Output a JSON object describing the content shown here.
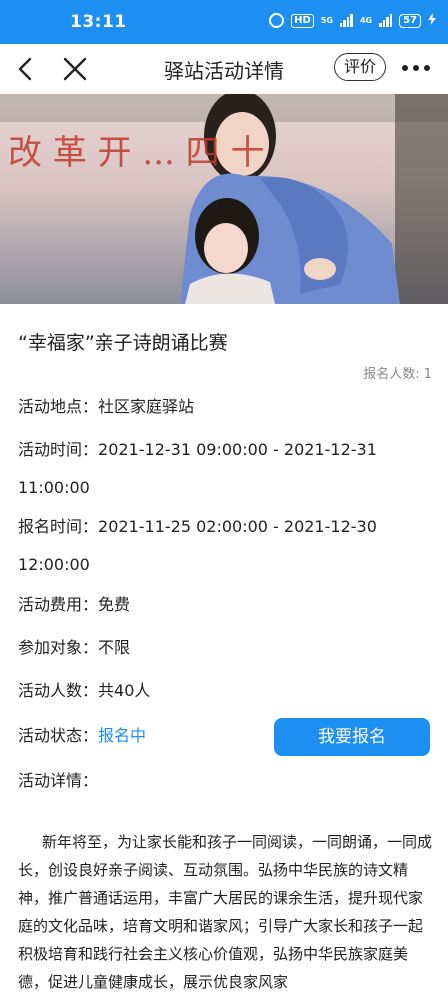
{
  "status_bar": {
    "time": "13:11",
    "hd": "HD",
    "net_5g": "5G",
    "net_4g": "4G",
    "battery": "57"
  },
  "nav": {
    "title": "驿站活动详情",
    "rate_label": "评价"
  },
  "activity": {
    "title": "“幸福家”亲子诗朗诵比赛",
    "signup_count": "报名人数: 1",
    "location_label": "活动地点：",
    "location": "社区家庭驿站",
    "time_label": "活动时间：",
    "time_line1": "2021-12-31 09:00:00 - 2021-12-31",
    "time_line2": "11:00:00",
    "signup_time_label": "报名时间：",
    "signup_time_line1": "2021-11-25 02:00:00 - 2021-12-30",
    "signup_time_line2": "12:00:00",
    "fee_label": "活动费用：",
    "fee": "免费",
    "audience_label": "参加对象：",
    "audience": "不限",
    "capacity_label": "活动人数：",
    "capacity": "共40人",
    "status_label": "活动状态：",
    "status": "报名中",
    "signup_button": "我要报名",
    "details_label": "活动详情：",
    "description": "新年将至，为让家长能和孩子一同阅读，一同朗诵，一同成长，创设良好亲子阅读、互动氛围。弘扬中华民族的诗文精神，推广普通话运用，丰富广大居民的课余生活，提升现代家庭的文化品味，培育文明和谐家风；引导广大家长和孩子一起积极培育和践行社会主义核心价值观，弘扬中华民族家庭美德，促进儿童健康成长，展示优良家风家"
  },
  "banner": {
    "background_text": "改 革 开 ... 四 十"
  },
  "colors": {
    "accent": "#1d8ef2"
  }
}
